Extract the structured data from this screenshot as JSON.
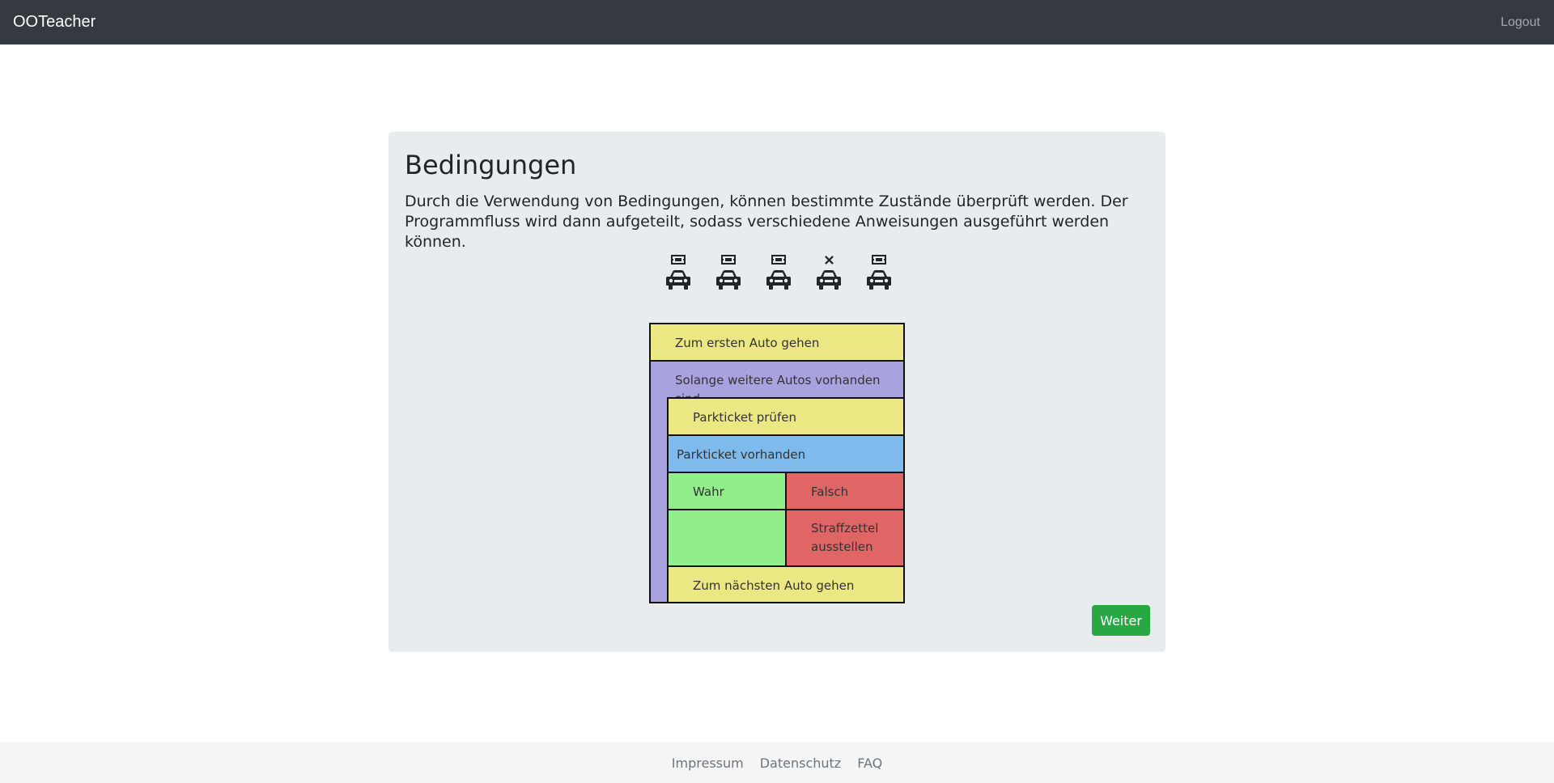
{
  "navbar": {
    "brand": "OOTeacher",
    "logout": "Logout"
  },
  "card": {
    "title": "Bedingungen",
    "lead": "Durch die Verwendung von Bedingungen, können bestimmte Zustände überprüft werden. Der Programmfluss wird dann aufgeteilt, sodass verschiedene Anweisungen ausgeführt werden können."
  },
  "cars": [
    {
      "has_ticket": true,
      "top_icon": "ticket-icon"
    },
    {
      "has_ticket": true,
      "top_icon": "ticket-icon"
    },
    {
      "has_ticket": true,
      "top_icon": "ticket-icon"
    },
    {
      "has_ticket": false,
      "top_icon": "cross-icon"
    },
    {
      "has_ticket": true,
      "top_icon": "ticket-icon"
    }
  ],
  "diagram": {
    "step1": "Zum ersten Auto gehen",
    "loop": "Solange weitere Autos vorhanden sind",
    "check": "Parkticket prüfen",
    "condition": "Parkticket vorhanden",
    "true_label": "Wahr",
    "false_label": "Falsch",
    "false_action": "Straffzettel ausstellen",
    "next": "Zum nächsten Auto gehen"
  },
  "colors": {
    "statement": "#ebe783",
    "loop": "#a8a2df",
    "condition": "#7ebaeb",
    "true_branch": "#91ee8b",
    "false_branch": "#e06666",
    "button": "#28a745"
  },
  "buttons": {
    "next": "Weiter"
  },
  "footer": {
    "impressum": "Impressum",
    "datenschutz": "Datenschutz",
    "faq": "FAQ"
  }
}
